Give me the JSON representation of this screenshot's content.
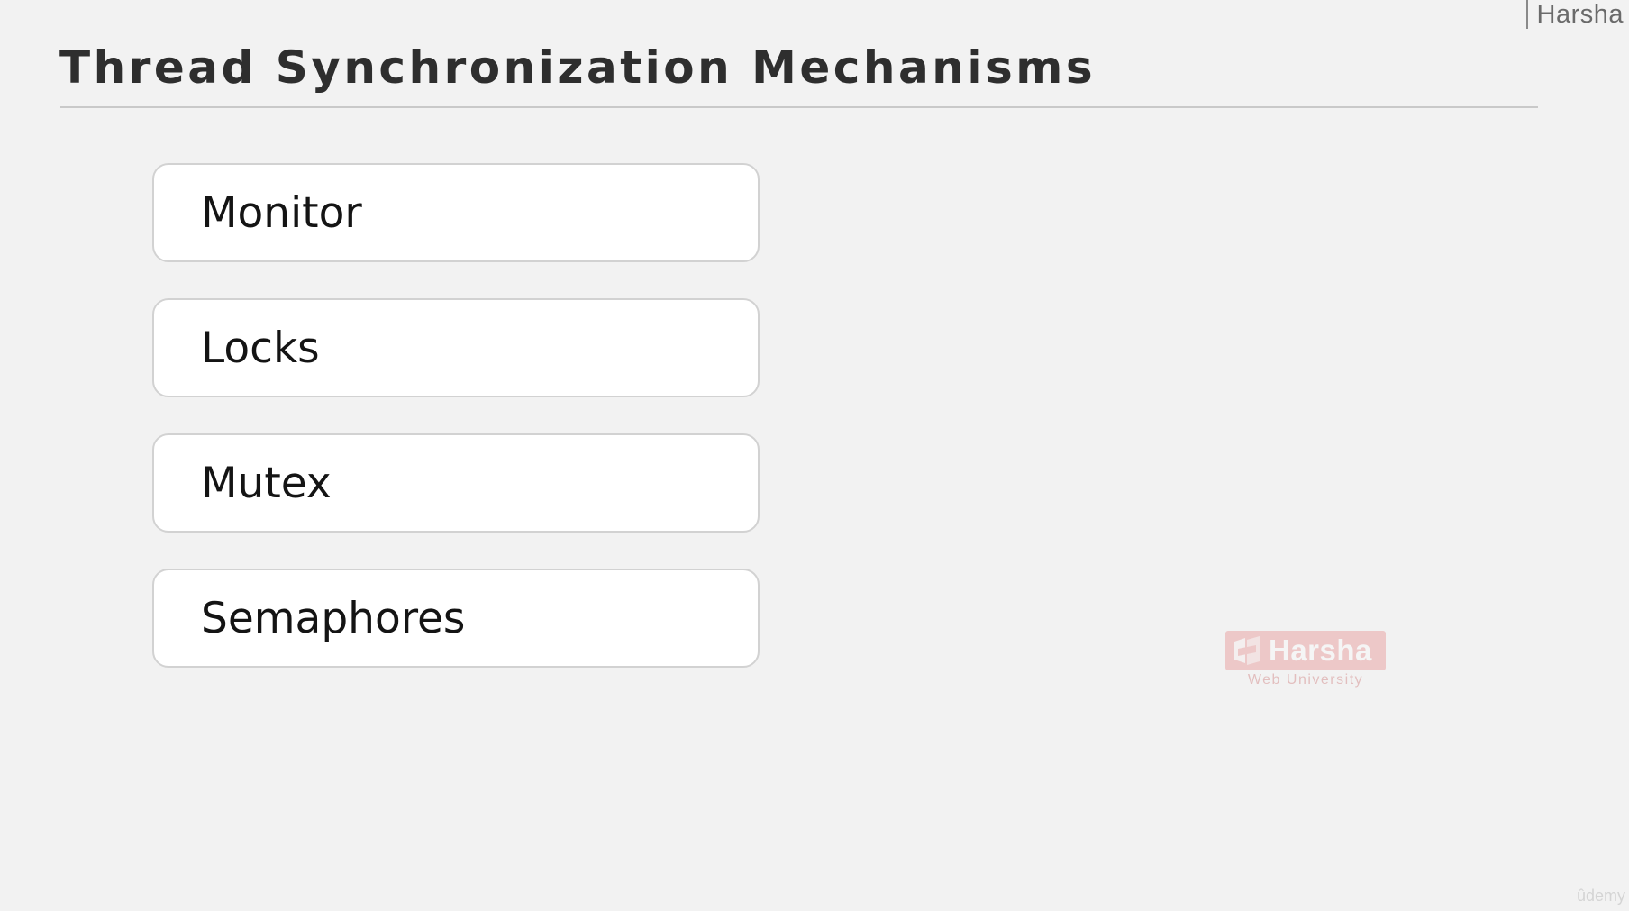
{
  "header": {
    "author_tag": "Harsha",
    "title": "Thread Synchronization Mechanisms"
  },
  "mechanisms": [
    {
      "label": "Monitor"
    },
    {
      "label": "Locks"
    },
    {
      "label": "Mutex"
    },
    {
      "label": "Semaphores"
    }
  ],
  "watermark": {
    "name": "Harsha",
    "subtitle": "Web University",
    "logo_icon": "harsha-logo-icon",
    "color": "#e36a6a"
  },
  "platform_mark": "ûdemy",
  "colors": {
    "background": "#f2f2f2",
    "card_background": "#ffffff",
    "card_border": "#d2d2d2",
    "title_text": "#2e2e2e"
  }
}
